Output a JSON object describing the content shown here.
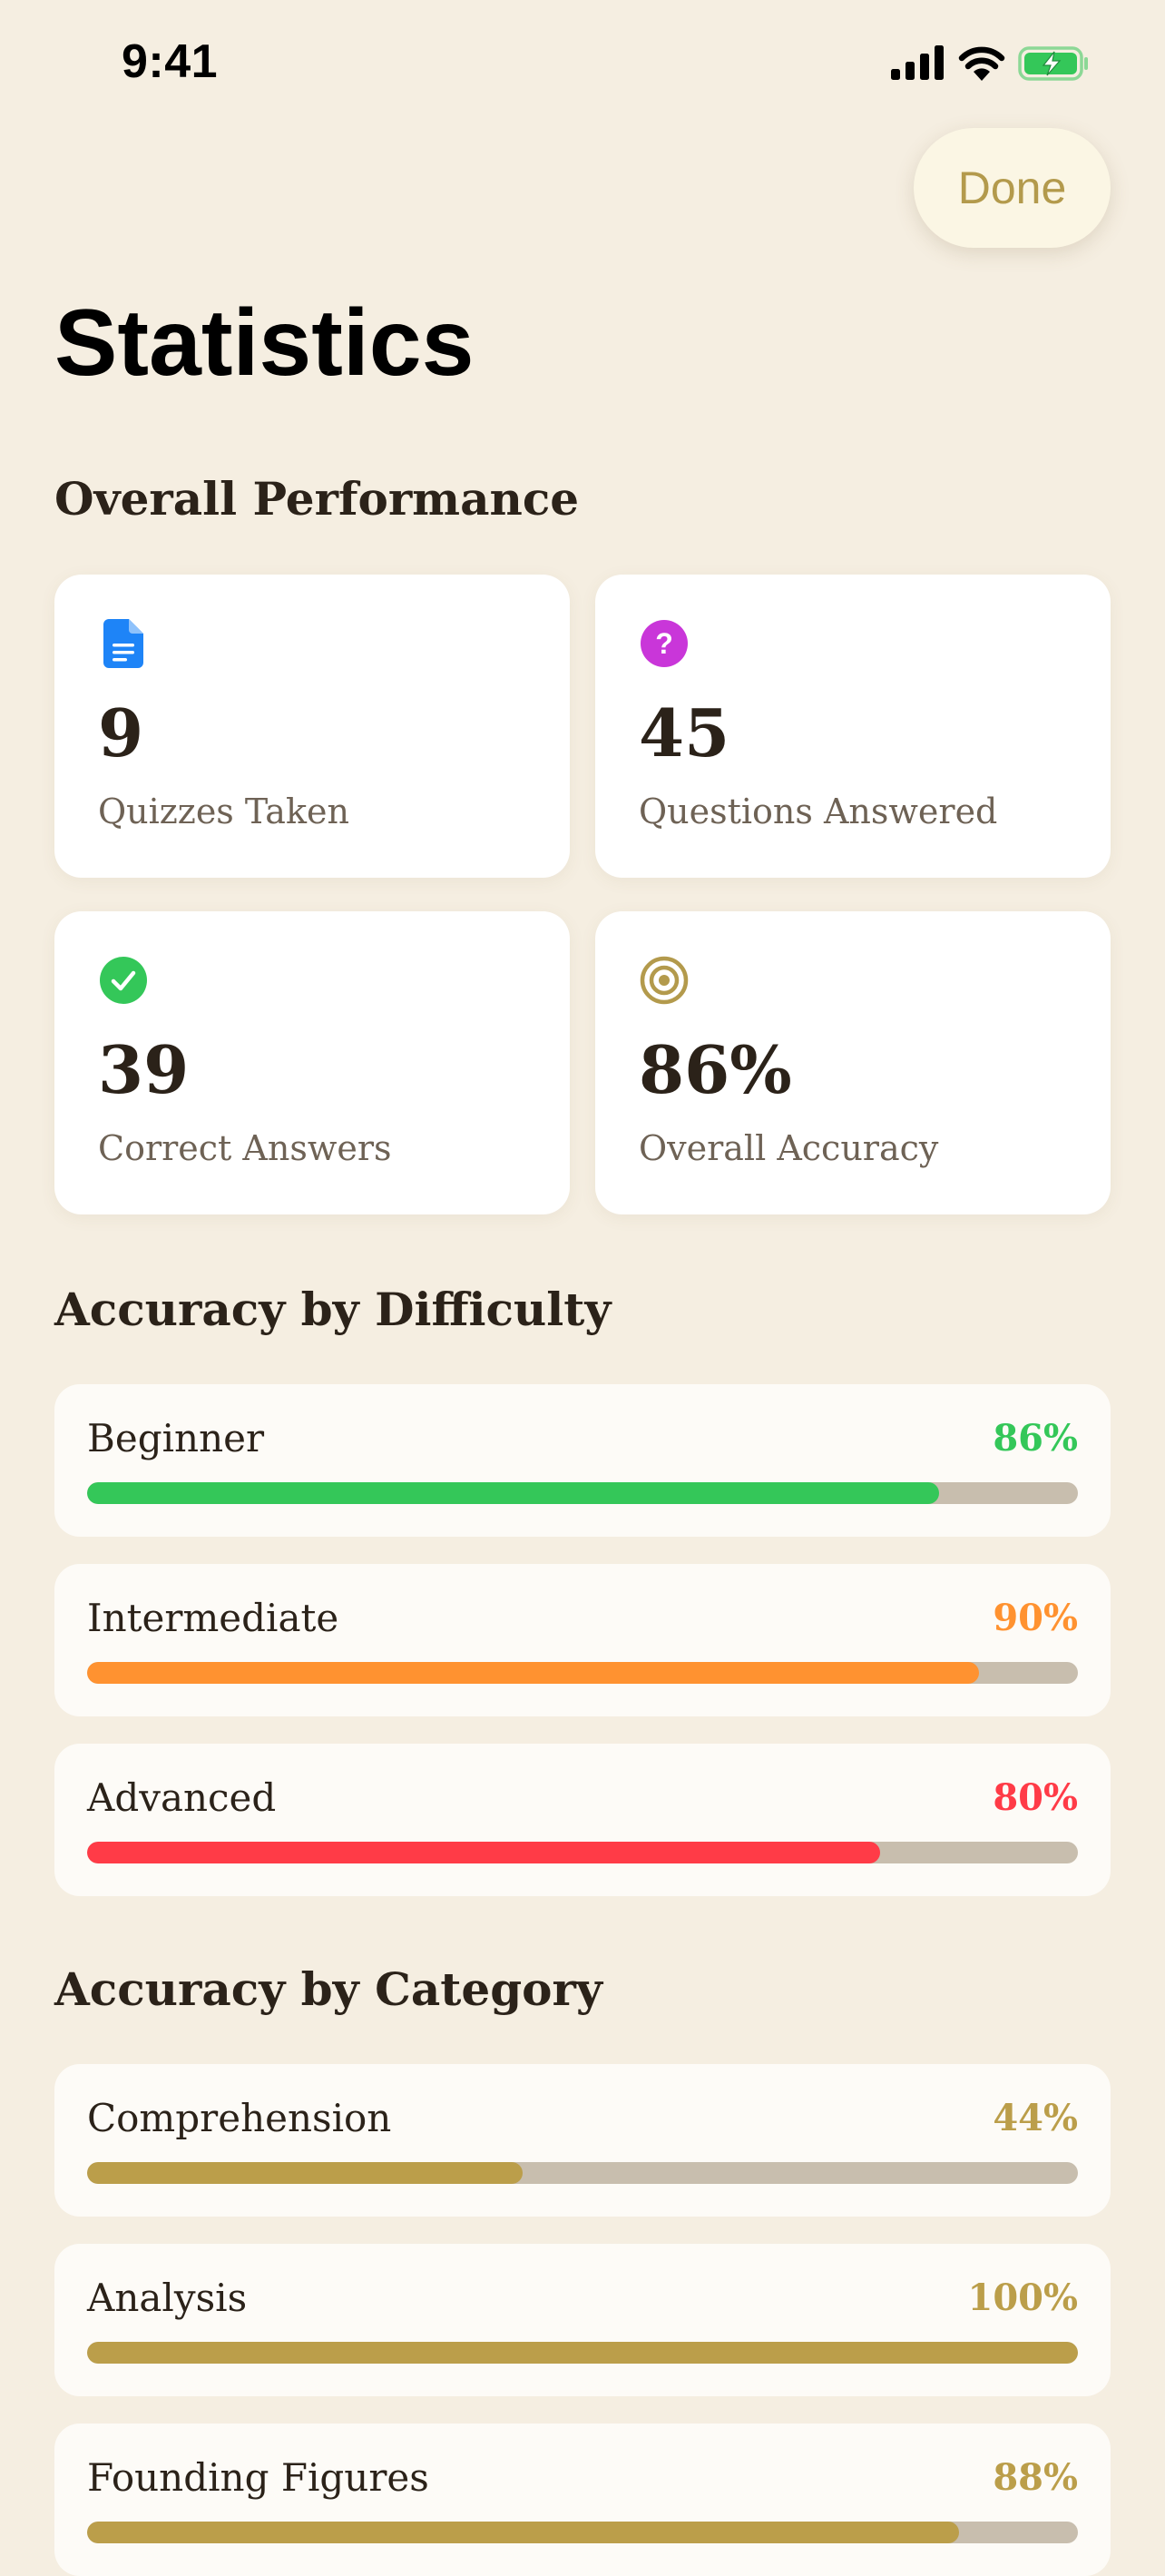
{
  "status_bar": {
    "time": "9:41"
  },
  "header": {
    "done_label": "Done",
    "title": "Statistics"
  },
  "overall": {
    "heading": "Overall Performance",
    "cards": [
      {
        "icon": "document-icon",
        "color": "#1E84F7",
        "value": "9",
        "label": "Quizzes Taken"
      },
      {
        "icon": "question-circle-icon",
        "color": "#C936D9",
        "value": "45",
        "label": "Questions Answered"
      },
      {
        "icon": "checkmark-circle-icon",
        "color": "#34C759",
        "value": "39",
        "label": "Correct Answers"
      },
      {
        "icon": "target-icon",
        "color": "#B39A4C",
        "value": "86%",
        "label": "Overall Accuracy"
      }
    ]
  },
  "difficulty": {
    "heading": "Accuracy by Difficulty",
    "rows": [
      {
        "label": "Beginner",
        "value": "86%",
        "fraction": 0.86,
        "color": "#34C759"
      },
      {
        "label": "Intermediate",
        "value": "90%",
        "fraction": 0.9,
        "color": "#FF9230"
      },
      {
        "label": "Advanced",
        "value": "80%",
        "fraction": 0.8,
        "color": "#FF3B47"
      }
    ]
  },
  "category": {
    "heading": "Accuracy by Category",
    "rows": [
      {
        "label": "Comprehension",
        "value": "44%",
        "fraction": 0.44,
        "color": "#BB9E4A"
      },
      {
        "label": "Analysis",
        "value": "100%",
        "fraction": 1.0,
        "color": "#BB9E4A"
      },
      {
        "label": "Founding Figures",
        "value": "88%",
        "fraction": 0.88,
        "color": "#BB9E4A"
      }
    ]
  }
}
